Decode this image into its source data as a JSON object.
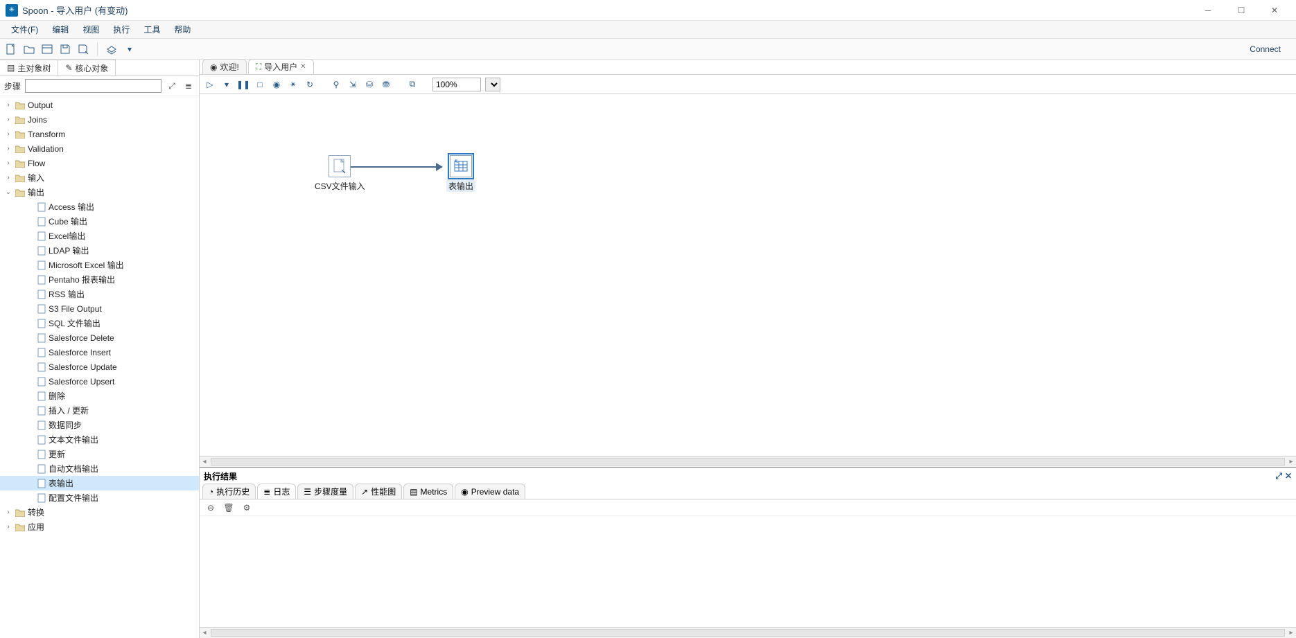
{
  "window": {
    "title": "Spoon - 导入用户 (有变动)"
  },
  "menu": {
    "file": "文件(F)",
    "edit": "编辑",
    "view": "视图",
    "run": "执行",
    "tools": "工具",
    "help": "帮助"
  },
  "toolbar_right": {
    "connect": "Connect"
  },
  "side_tabs": {
    "tree": "主对象树",
    "core": "核心对象"
  },
  "steps": {
    "label": "步骤",
    "filter_value": ""
  },
  "tree": {
    "top": [
      {
        "label": "Output"
      },
      {
        "label": "Joins"
      },
      {
        "label": "Transform"
      },
      {
        "label": "Validation"
      },
      {
        "label": "Flow"
      },
      {
        "label": "输入"
      }
    ],
    "output_group": "输出",
    "output_children": [
      "Access 输出",
      "Cube 输出",
      "Excel输出",
      "LDAP 输出",
      "Microsoft Excel 输出",
      "Pentaho 报表输出",
      "RSS 输出",
      "S3 File Output",
      "SQL 文件输出",
      "Salesforce Delete",
      "Salesforce Insert",
      "Salesforce Update",
      "Salesforce Upsert",
      "删除",
      "插入 / 更新",
      "数据同步",
      "文本文件输出",
      "更新",
      "自动文档输出",
      "表输出",
      "配置文件输出"
    ],
    "selected_child_index": 19,
    "bottom": [
      {
        "label": "转换"
      },
      {
        "label": "应用"
      }
    ]
  },
  "editor_tabs": {
    "welcome": "欢迎!",
    "transform": "导入用户"
  },
  "canvas_toolbar": {
    "zoom": "100%"
  },
  "canvas": {
    "node1": {
      "label": "CSV文件输入"
    },
    "node2": {
      "label": "表输出"
    }
  },
  "results": {
    "title": "执行结果",
    "tabs": {
      "history": "执行历史",
      "log": "日志",
      "step_metrics": "步骤度量",
      "perf": "性能图",
      "metrics": "Metrics",
      "preview": "Preview data"
    }
  }
}
